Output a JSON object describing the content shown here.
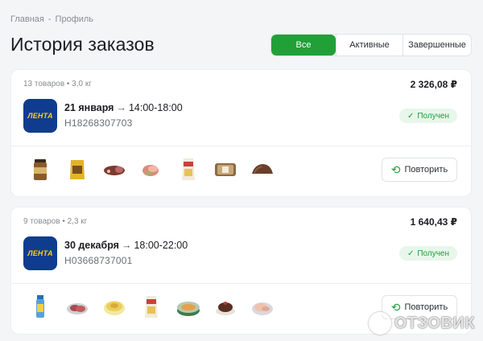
{
  "breadcrumb": {
    "home": "Главная",
    "separator": "-",
    "current": "Профиль"
  },
  "page_title": "История заказов",
  "filters": [
    {
      "label": "Все",
      "active": true
    },
    {
      "label": "Активные",
      "active": false
    },
    {
      "label": "Завершенные",
      "active": false
    }
  ],
  "orders": [
    {
      "meta": "13 товаров • 3,0 кг",
      "total": "2 326,08 ₽",
      "store_logo": "ЛЕНТА",
      "date": "21 января",
      "time": "14:00-18:00",
      "order_number": "H18268307703",
      "status": "Получен",
      "repeat_label": "Повторить",
      "items": [
        "coffee-jar",
        "coffee-pack",
        "sausage",
        "meat-slice",
        "dairy-bag",
        "bread-pack",
        "chocolate"
      ]
    },
    {
      "meta": "9 товаров • 2,3 кг",
      "total": "1 640,43 ₽",
      "store_logo": "ЛЕНТА",
      "date": "30 декабря",
      "time": "18:00-22:00",
      "order_number": "H03668737001",
      "status": "Получен",
      "repeat_label": "Повторить",
      "items": [
        "bottle",
        "meat-tray",
        "dessert-cup",
        "dairy-bag",
        "canned-fish",
        "cake",
        "chicken"
      ]
    }
  ],
  "watermark": "ОТЗОВИК",
  "colors": {
    "accent": "#21a038",
    "logo_bg": "#0f3c8f",
    "logo_text": "#ffd400"
  }
}
